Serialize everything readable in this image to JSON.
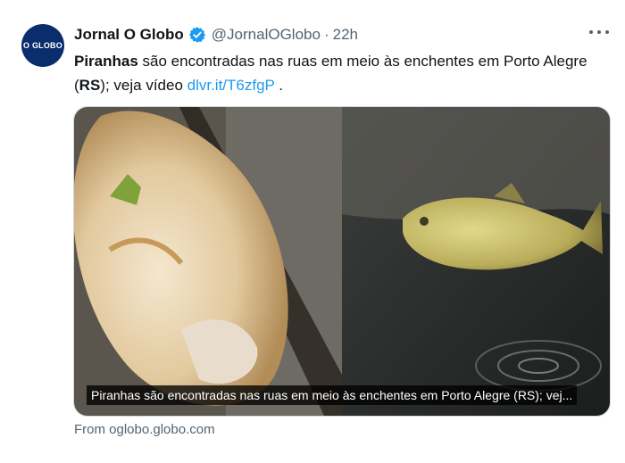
{
  "account": {
    "avatar_text": "O GLOBO",
    "name": "Jornal O Globo",
    "handle": "@JornalOGlobo",
    "separator": "·",
    "time": "22h"
  },
  "tweet": {
    "text_bold": "Piranhas",
    "text_part1": " são encontradas nas ruas em meio às enchentes em Porto Alegre (",
    "text_bold2": "RS",
    "text_part2": "); veja vídeo ",
    "link": "dlvr.it/T6zfgP",
    "text_end": " ."
  },
  "media": {
    "caption": "Piranhas são encontradas nas ruas em meio às enchentes em Porto Alegre (RS); vej..."
  },
  "card": {
    "source": "From oglobo.globo.com"
  },
  "colors": {
    "accent": "#1d9bf0",
    "muted": "#536471",
    "avatar_bg": "#0a2d6e"
  },
  "icons": [
    "verified-badge-icon",
    "more-options-icon"
  ]
}
